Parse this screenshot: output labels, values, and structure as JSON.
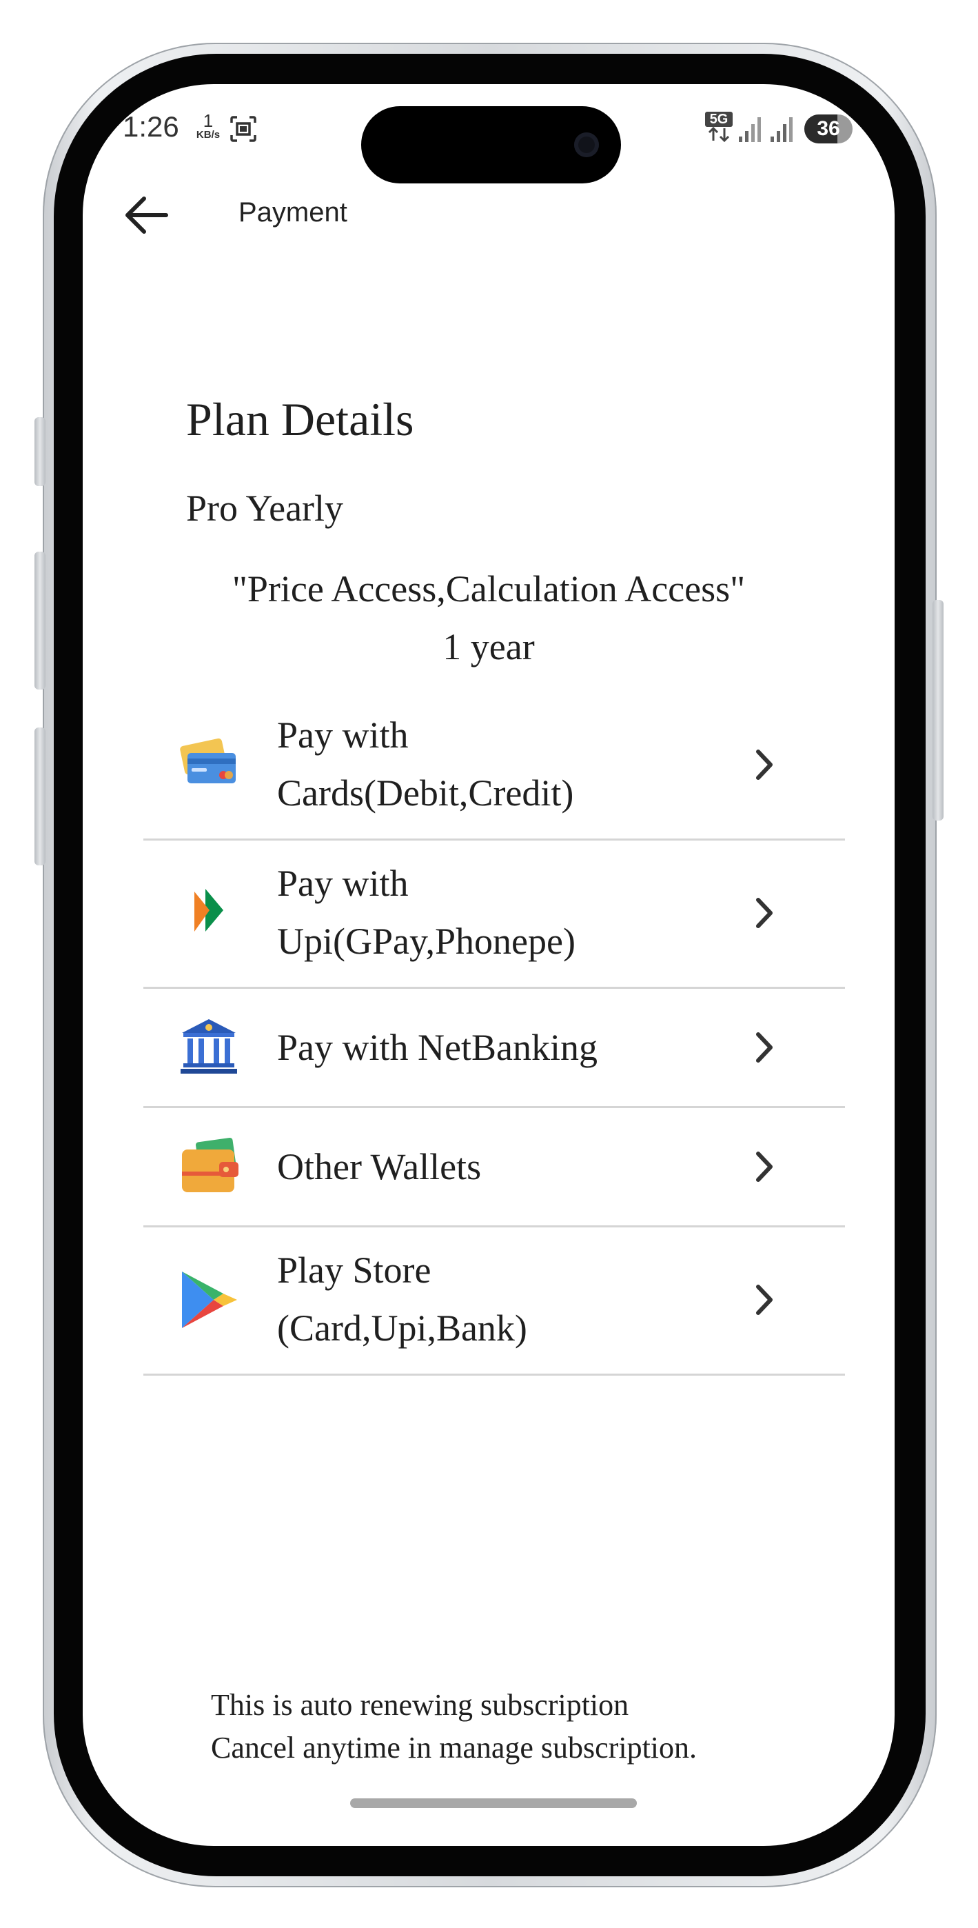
{
  "status_bar": {
    "time": "1:26",
    "net_speed_value": "1",
    "net_speed_unit": "KB/s",
    "network_type": "5G",
    "battery_level": "36"
  },
  "app_bar": {
    "title": "Payment"
  },
  "plan": {
    "heading": "Plan Details",
    "name": "Pro Yearly",
    "features": "\"Price Access,Calculation Access\"",
    "duration": "1 year"
  },
  "payment_options": [
    {
      "line1": "Pay with",
      "line2": "Cards(Debit,Credit)",
      "icon": "credit-card-icon"
    },
    {
      "line1": "Pay with",
      "line2": "Upi(GPay,Phonepe)",
      "icon": "upi-icon"
    },
    {
      "line1": "Pay with NetBanking",
      "icon": "bank-icon"
    },
    {
      "line1": "Other Wallets",
      "icon": "wallet-icon"
    },
    {
      "line1": "Play Store",
      "line2": "(Card,Upi,Bank)",
      "icon": "play-store-icon"
    }
  ],
  "footer": {
    "line1": "This is auto renewing subscription",
    "line2": "Cancel anytime in manage subscription."
  }
}
